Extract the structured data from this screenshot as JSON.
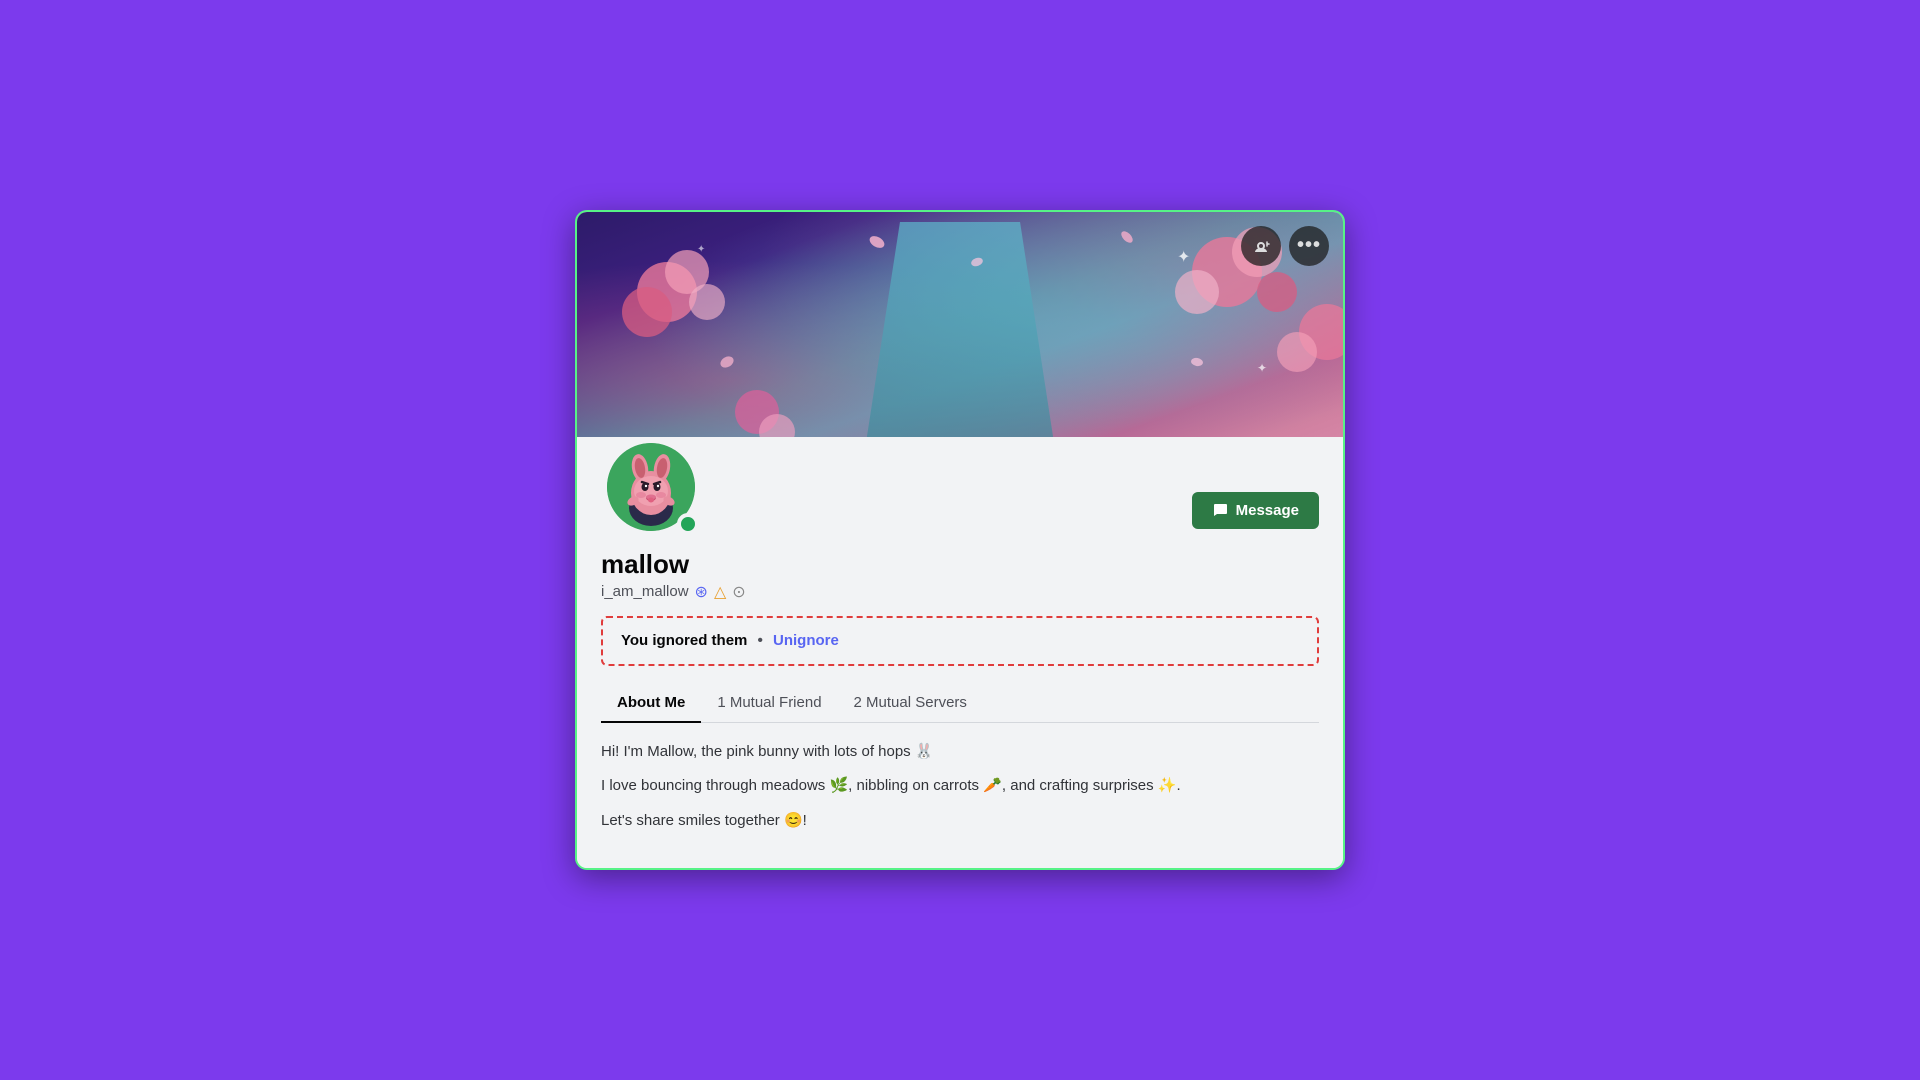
{
  "card": {
    "banner_alt": "Cherry blossom fantasy banner"
  },
  "header_buttons": {
    "add_friend_label": "👤",
    "more_options_label": "•••"
  },
  "profile": {
    "display_name": "mallow",
    "handle": "i_am_mallow",
    "badges": [
      "⊙",
      "△",
      "⊙"
    ],
    "status": "online",
    "message_button": "Message"
  },
  "ignored": {
    "text": "You ignored them",
    "separator": "•",
    "unignore_label": "Unignore"
  },
  "tabs": [
    {
      "label": "About Me",
      "active": true
    },
    {
      "label": "1 Mutual Friend",
      "active": false
    },
    {
      "label": "2 Mutual Servers",
      "active": false
    }
  ],
  "bio": {
    "lines": [
      "Hi! I'm Mallow, the pink bunny with lots of hops 🐰",
      "I love bouncing through meadows 🌿, nibbling on carrots 🥕, and crafting surprises ✨.",
      "Let's share smiles together 😊!"
    ]
  }
}
